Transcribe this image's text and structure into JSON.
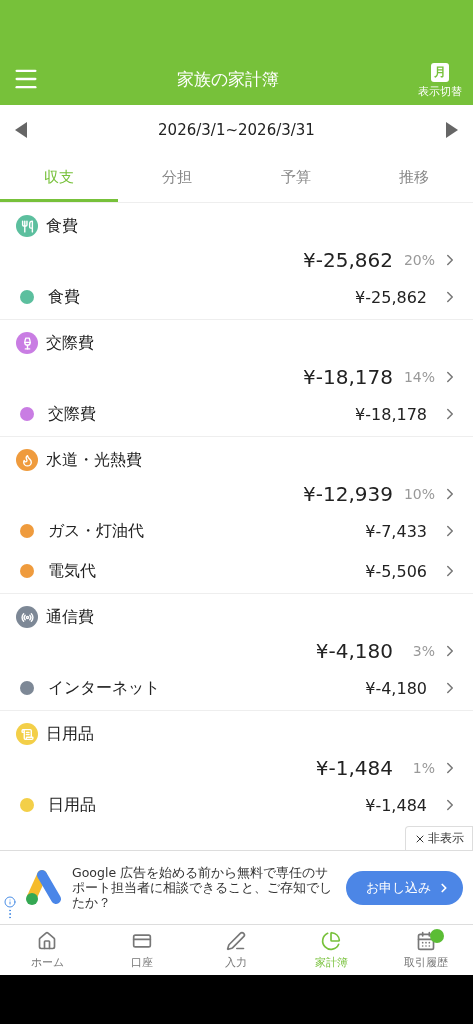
{
  "header": {
    "title": "家族の家計簿",
    "view_toggle": {
      "icon_text": "月",
      "label": "表示切替"
    }
  },
  "period": {
    "range": "2026/3/1~2026/3/31"
  },
  "tabs": [
    {
      "label": "収支",
      "selected": true
    },
    {
      "label": "分担",
      "selected": false
    },
    {
      "label": "予算",
      "selected": false
    },
    {
      "label": "推移",
      "selected": false
    }
  ],
  "categories": [
    {
      "name": "食費",
      "total": "¥-25,862",
      "share": "20%",
      "color": "#5cbf9e",
      "items": [
        {
          "name": "食費",
          "amount": "¥-25,862",
          "color": "#5cbf9e"
        }
      ]
    },
    {
      "name": "交際費",
      "total": "¥-18,178",
      "share": "14%",
      "color": "#c97de3",
      "items": [
        {
          "name": "交際費",
          "amount": "¥-18,178",
          "color": "#c97de3"
        }
      ]
    },
    {
      "name": "水道・光熱費",
      "total": "¥-12,939",
      "share": "10%",
      "color": "#ef9b3d",
      "items": [
        {
          "name": "ガス・灯油代",
          "amount": "¥-7,433",
          "color": "#ef9b3d"
        },
        {
          "name": "電気代",
          "amount": "¥-5,506",
          "color": "#ef9b3d"
        }
      ]
    },
    {
      "name": "通信費",
      "total": "¥-4,180",
      "share": "3%",
      "color": "#7d8896",
      "items": [
        {
          "name": "インターネット",
          "amount": "¥-4,180",
          "color": "#7d8896"
        }
      ]
    },
    {
      "name": "日用品",
      "total": "¥-1,484",
      "share": "1%",
      "color": "#f3cf48",
      "items": [
        {
          "name": "日用品",
          "amount": "¥-1,484",
          "color": "#f3cf48"
        }
      ]
    }
  ],
  "ad": {
    "hide_label": "非表示",
    "text": "Google 広告を始める前から無料で専任のサポート担当者に相談できること、ご存知でしたか？",
    "button": "お申し込み"
  },
  "bottom_nav": [
    {
      "label": "ホーム",
      "selected": false,
      "badge": false
    },
    {
      "label": "口座",
      "selected": false,
      "badge": false
    },
    {
      "label": "入力",
      "selected": false,
      "badge": false
    },
    {
      "label": "家計簿",
      "selected": true,
      "badge": false
    },
    {
      "label": "取引履歴",
      "selected": false,
      "badge": true
    }
  ]
}
